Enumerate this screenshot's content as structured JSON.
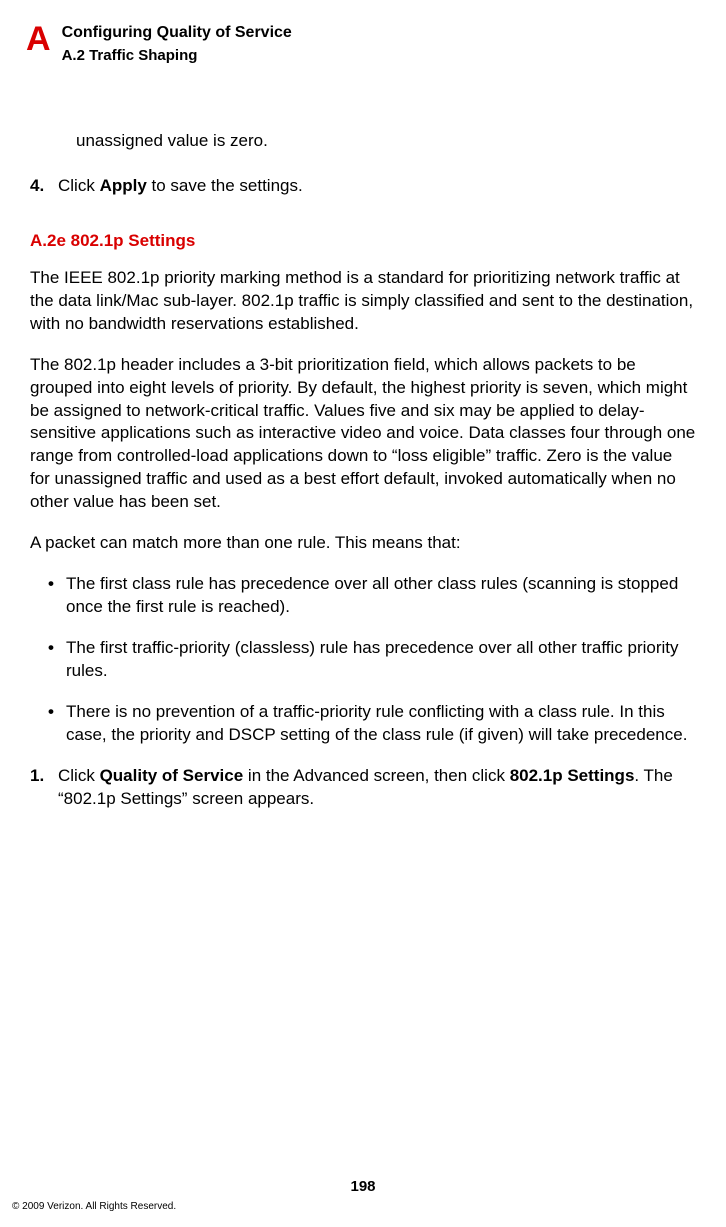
{
  "header": {
    "letter": "A",
    "title1": "Configuring Quality of Service",
    "title2": "A.2  Traffic Shaping"
  },
  "prev_fragment": "unassigned value is zero.",
  "step4": {
    "num": "4.",
    "pre": "Click ",
    "bold": "Apply",
    "post": " to save the settings."
  },
  "section_heading": "A.2e  802.1p Settings",
  "para1": "The IEEE 802.1p priority marking method is a standard for prioritizing network traffic at the data link/Mac sub-layer. 802.1p traffic is simply classified and sent to the destination, with no bandwidth reservations established.",
  "para2": "The 802.1p header includes a 3-bit prioritization field, which allows packets to be grouped into eight levels of priority. By default, the highest priority is seven, which might be assigned to network-critical traffic. Values five and six may be applied to delay-sensitive applications such as interactive video and voice. Data classes four through one range from controlled-load applications down to “loss eligible” traffic. Zero is the value for unassigned traffic and used as a best effort default, invoked automatically when no other value has been set.",
  "para3": "A packet can match more than one rule. This means that:",
  "bullets": [
    "The first class rule has precedence over all other class rules (scanning is stopped once the first rule is reached).",
    "The first traffic-priority (classless) rule has precedence over all other traffic priority rules.",
    "There is no prevention of a traffic-priority rule conflicting with a class rule. In this case, the priority and DSCP setting of the class rule (if given) will take precedence."
  ],
  "step1": {
    "num": "1.",
    "pre": "Click ",
    "bold1": "Quality of Service",
    "mid": " in the Advanced screen, then click ",
    "bold2": "802.1p Settings",
    "post": ". The “802.1p Settings” screen appears."
  },
  "page_number": "198",
  "copyright": "© 2009 Verizon. All Rights Reserved."
}
